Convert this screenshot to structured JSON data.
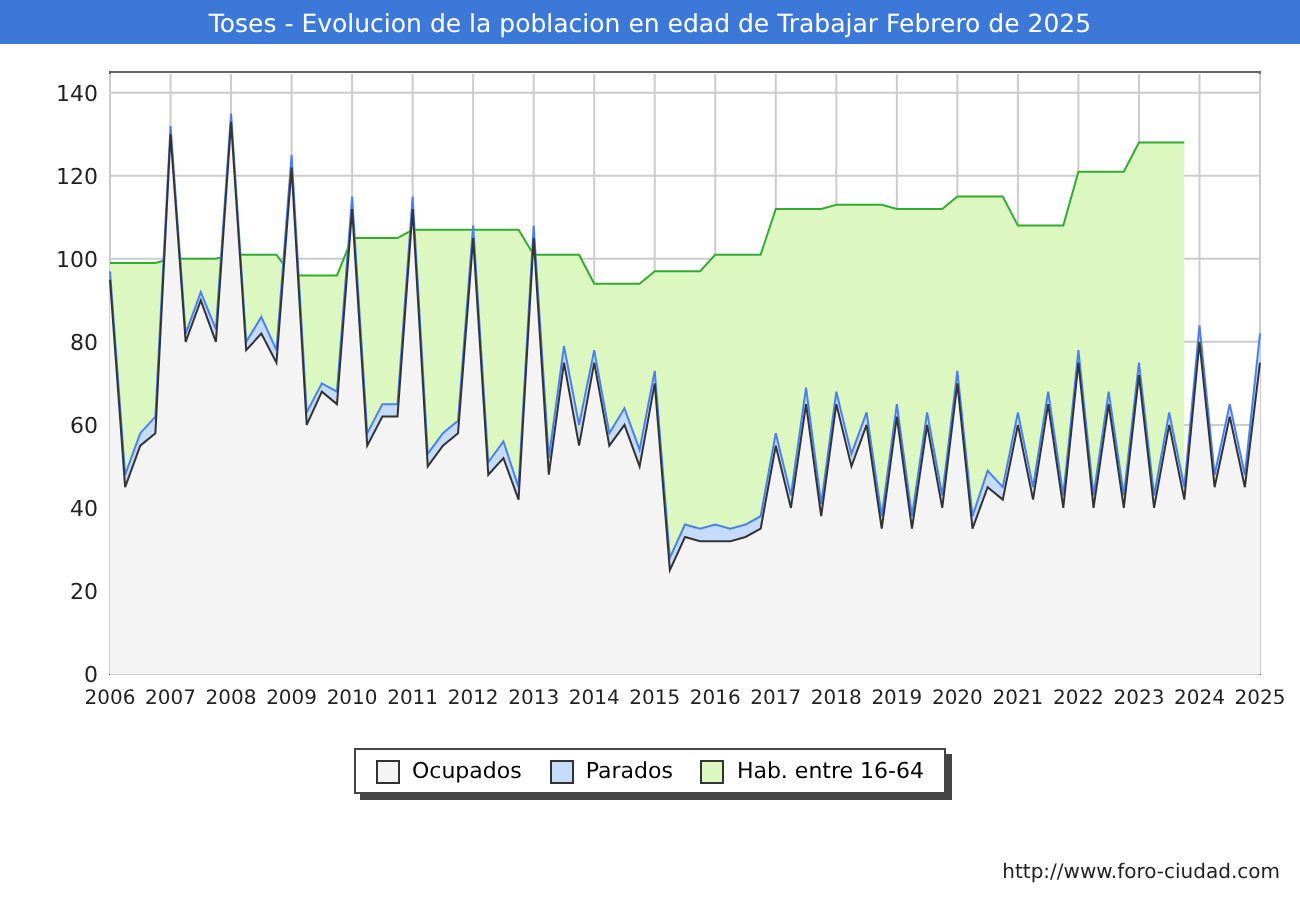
{
  "title": "Toses - Evolucion de la poblacion en edad de Trabajar Febrero de 2025",
  "chart": {
    "chart_data": {
      "type": "area",
      "stacked": false,
      "x": [
        2006,
        2006.25,
        2006.5,
        2006.75,
        2007,
        2007.25,
        2007.5,
        2007.75,
        2008,
        2008.25,
        2008.5,
        2008.75,
        2009,
        2009.25,
        2009.5,
        2009.75,
        2010,
        2010.25,
        2010.5,
        2010.75,
        2011,
        2011.25,
        2011.5,
        2011.75,
        2012,
        2012.25,
        2012.5,
        2012.75,
        2013,
        2013.25,
        2013.5,
        2013.75,
        2014,
        2014.25,
        2014.5,
        2014.75,
        2015,
        2015.25,
        2015.5,
        2015.75,
        2016,
        2016.25,
        2016.5,
        2016.75,
        2017,
        2017.25,
        2017.5,
        2017.75,
        2018,
        2018.25,
        2018.5,
        2018.75,
        2019,
        2019.25,
        2019.5,
        2019.75,
        2020,
        2020.25,
        2020.5,
        2020.75,
        2021,
        2021.25,
        2021.5,
        2021.75,
        2022,
        2022.25,
        2022.5,
        2022.75,
        2023,
        2023.25,
        2023.5,
        2023.75,
        2024,
        2024.25,
        2024.5,
        2024.75,
        2025
      ],
      "series": [
        {
          "name": "Hab. entre 16-64",
          "color": "#ddf7c0",
          "values": [
            99,
            99,
            99,
            99,
            100,
            100,
            100,
            100,
            101,
            101,
            101,
            101,
            96,
            96,
            96,
            96,
            105,
            105,
            105,
            105,
            107,
            107,
            107,
            107,
            107,
            107,
            107,
            107,
            101,
            101,
            101,
            101,
            94,
            94,
            94,
            94,
            97,
            97,
            97,
            97,
            101,
            101,
            101,
            101,
            112,
            112,
            112,
            112,
            113,
            113,
            113,
            113,
            112,
            112,
            112,
            112,
            115,
            115,
            115,
            115,
            108,
            108,
            108,
            108,
            121,
            121,
            121,
            121,
            128,
            128,
            128,
            128,
            null,
            null,
            null,
            null,
            null
          ]
        },
        {
          "name": "Parados",
          "color": "#c6dcff",
          "values": [
            97,
            48,
            58,
            62,
            132,
            82,
            92,
            83,
            135,
            80,
            86,
            78,
            125,
            63,
            70,
            68,
            115,
            58,
            65,
            65,
            115,
            53,
            58,
            61,
            108,
            51,
            56,
            45,
            108,
            52,
            79,
            60,
            78,
            58,
            64,
            54,
            73,
            28,
            36,
            35,
            36,
            35,
            36,
            38,
            58,
            43,
            69,
            41,
            68,
            53,
            63,
            38,
            65,
            38,
            63,
            43,
            73,
            38,
            49,
            45,
            63,
            45,
            68,
            43,
            78,
            43,
            68,
            43,
            75,
            43,
            63,
            45,
            84,
            48,
            65,
            48,
            82
          ]
        },
        {
          "name": "Ocupados",
          "color": "#f4f4f4",
          "values": [
            95,
            45,
            55,
            58,
            130,
            80,
            90,
            80,
            133,
            78,
            82,
            75,
            122,
            60,
            68,
            65,
            112,
            55,
            62,
            62,
            112,
            50,
            55,
            58,
            105,
            48,
            52,
            42,
            105,
            48,
            75,
            55,
            75,
            55,
            60,
            50,
            70,
            25,
            33,
            32,
            32,
            32,
            33,
            35,
            55,
            40,
            65,
            38,
            65,
            50,
            60,
            35,
            62,
            35,
            60,
            40,
            70,
            35,
            45,
            42,
            60,
            42,
            65,
            40,
            75,
            40,
            65,
            40,
            72,
            40,
            60,
            42,
            80,
            45,
            62,
            45,
            75
          ]
        }
      ],
      "xticks": [
        2006,
        2007,
        2008,
        2009,
        2010,
        2011,
        2012,
        2013,
        2014,
        2015,
        2016,
        2017,
        2018,
        2019,
        2020,
        2021,
        2022,
        2023,
        2024,
        2025
      ],
      "yticks": [
        0,
        20,
        40,
        60,
        80,
        100,
        120,
        140
      ],
      "grid": true,
      "xlim": [
        2006,
        2025
      ],
      "ylim": [
        0,
        145
      ]
    }
  },
  "url": "http://www.foro-ciudad.com"
}
